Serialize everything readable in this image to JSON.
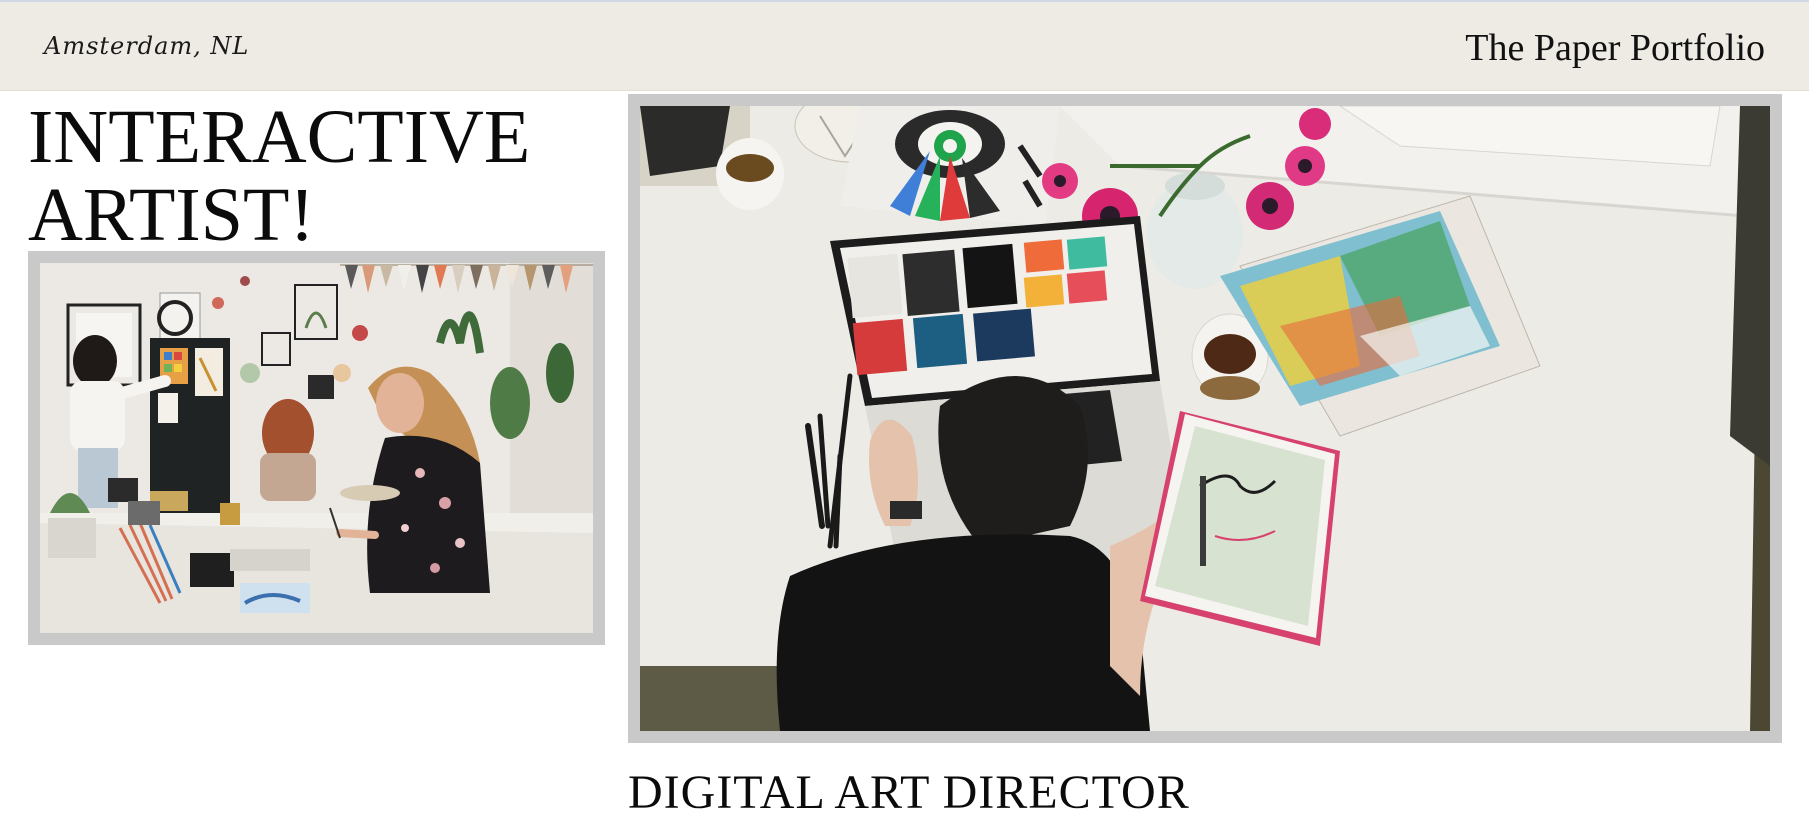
{
  "header": {
    "location": "Amsterdam, NL",
    "brand": "The Paper Portfolio"
  },
  "hero": {
    "title_line1": "INTERACTIVE",
    "title_line2": "ARTIST!"
  },
  "gallery": {
    "left_image": "art-studio-group-photo",
    "right_image": "desk-laptop-tablet-photo",
    "caption": "DIGITAL ART DIRECTOR"
  },
  "colors": {
    "header_bg": "#eeeae4",
    "frame": "#c9c9c9",
    "text": "#111111"
  }
}
